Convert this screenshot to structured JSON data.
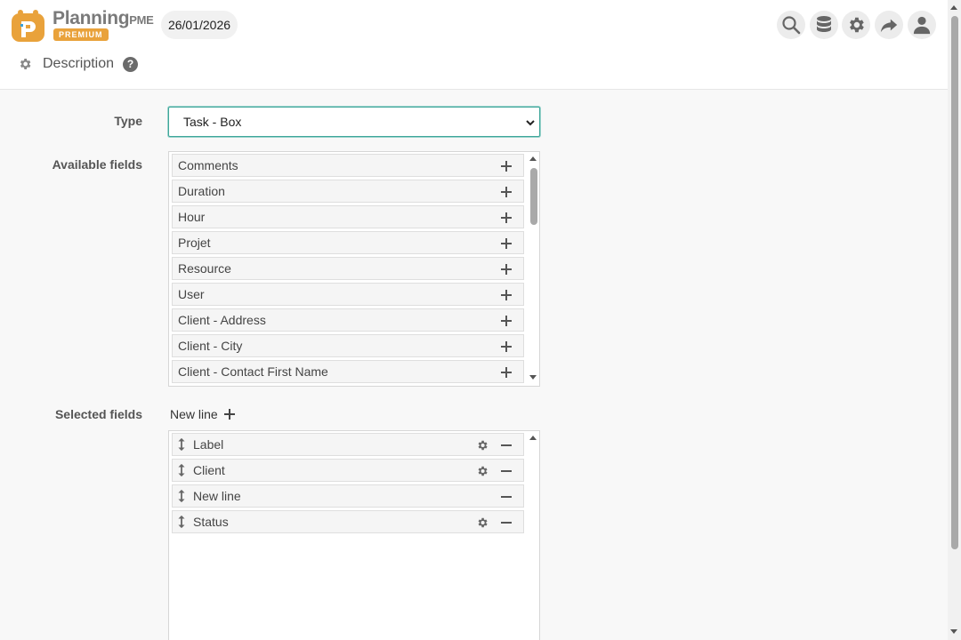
{
  "app": {
    "logo_word": "Planning",
    "logo_suffix": "PME",
    "logo_tag": "PREMIUM",
    "date": "26/01/2026"
  },
  "toolbar": {
    "icons": [
      "search-icon",
      "database-icon",
      "gear-icon",
      "share-icon",
      "user-icon"
    ]
  },
  "section": {
    "title": "Description",
    "help": "?"
  },
  "form": {
    "type_label": "Type",
    "type_value": "Task - Box",
    "available_label": "Available fields",
    "selected_label": "Selected fields",
    "new_line_label": "New line"
  },
  "available_fields": [
    "Comments",
    "Duration",
    "Hour",
    "Projet",
    "Resource",
    "User",
    "Client - Address",
    "Client - City",
    "Client - Contact First Name"
  ],
  "selected_fields": [
    {
      "label": "Label",
      "settings": true
    },
    {
      "label": "Client",
      "settings": true
    },
    {
      "label": "New line",
      "settings": false
    },
    {
      "label": "Status",
      "settings": true
    }
  ],
  "colors": {
    "accent": "#3fa69a",
    "brand": "#e9a23b"
  }
}
